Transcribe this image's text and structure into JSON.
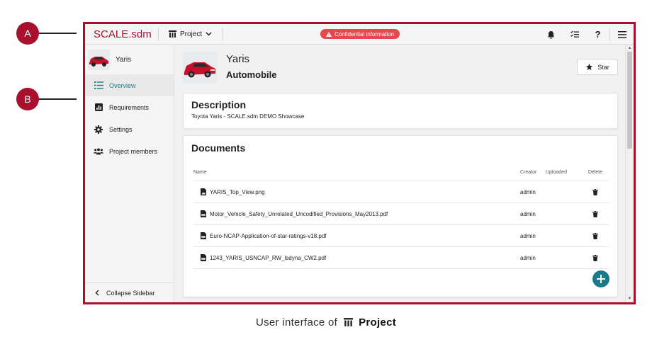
{
  "annotations": {
    "a": "A",
    "b": "B"
  },
  "app": {
    "brand": "SCALE.sdm",
    "project_menu_label": "Project",
    "confidential_label": "Confidential information"
  },
  "sidebar": {
    "project_name": "Yaris",
    "items": [
      {
        "label": "Overview",
        "icon": "list-icon",
        "active": true
      },
      {
        "label": "Requirements",
        "icon": "chart-icon",
        "active": false
      },
      {
        "label": "Settings",
        "icon": "gear-icon",
        "active": false
      },
      {
        "label": "Project members",
        "icon": "people-icon",
        "active": false
      }
    ],
    "collapse_label": "Collapse Sidebar"
  },
  "main": {
    "title": "Yaris",
    "subtitle": "Automobile",
    "star_label": "Star",
    "description": {
      "heading": "Description",
      "text": "Toyota Yaris - SCALE.sdm DEMO Showcase"
    },
    "documents": {
      "heading": "Documents",
      "columns": {
        "name": "Name",
        "creator": "Creator",
        "uploaded": "Uploaded",
        "delete": "Delete"
      },
      "rows": [
        {
          "name": "YARIS_Top_View.png",
          "type": "image-file-icon",
          "creator": "admin"
        },
        {
          "name": "Motor_Vehicle_Safety_Unrelated_Uncodified_Provisions_May2013.pdf",
          "type": "pdf-file-icon",
          "creator": "admin"
        },
        {
          "name": "Euro-NCAP-Application-of-star-ratings-v18.pdf",
          "type": "pdf-file-icon",
          "creator": "admin"
        },
        {
          "name": "1243_YARIS_USNCAP_RW_lsdyna_CW2.pdf",
          "type": "pdf-file-icon",
          "creator": "admin"
        }
      ]
    }
  },
  "caption": {
    "prefix": "User interface of",
    "bold": "Project"
  },
  "colors": {
    "brand": "#a8102e",
    "accent": "#1a7a8c",
    "badge": "#e5484d"
  }
}
